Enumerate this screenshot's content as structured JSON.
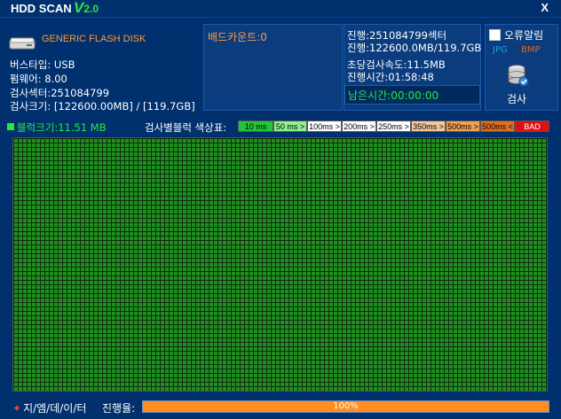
{
  "titlebar": {
    "app_title": "HDD SCAN",
    "version_letter": "V",
    "version_num": "2.0",
    "close_label": "X"
  },
  "device": {
    "name": "GENERIC FLASH DISK",
    "bus_type": "버스타입: USB",
    "firmware": "펌웨어: 8.00",
    "sectors": "검사섹터:251084799",
    "scan_size": "검사크기: [122600.00MB] / [119.7GB]"
  },
  "bad": {
    "count_label": "배드카운트:0"
  },
  "progress_info": {
    "sector_progress": "진행:251084799섹터",
    "size_progress": "진행:122600.0MB/119.7GB",
    "speed": "초당검사속도:11.5MB",
    "elapsed": "진행시간:01:58:48",
    "remaining": "남은시간:00:00:00"
  },
  "options": {
    "error_alarm": "오류알림",
    "error_alarm_checked": false,
    "jpg": "JPG",
    "bmp": "BMP",
    "scan_button": "검사"
  },
  "block": {
    "size_label": "블럭크기:11.51 MB",
    "legend_title": "검사별블럭 색상표:"
  },
  "legend": [
    {
      "label": "10 ms",
      "color": "#23c43a"
    },
    {
      "label": "50 ms >",
      "color": "#8ef08e"
    },
    {
      "label": "100ms >",
      "color": "#ffffff"
    },
    {
      "label": "200ms >",
      "color": "#ffffff"
    },
    {
      "label": "250ms >",
      "color": "#ffffff"
    },
    {
      "label": "350ms >",
      "color": "#f6c89a"
    },
    {
      "label": "500ms >",
      "color": "#f0a050"
    },
    {
      "label": "500ms <",
      "color": "#e07020"
    },
    {
      "label": "BAD",
      "color": "#e01010"
    }
  ],
  "footer": {
    "brand": "지/엠/데/이/터",
    "progress_label": "진행율:",
    "progress_text": "100%",
    "progress_percent": 100
  }
}
